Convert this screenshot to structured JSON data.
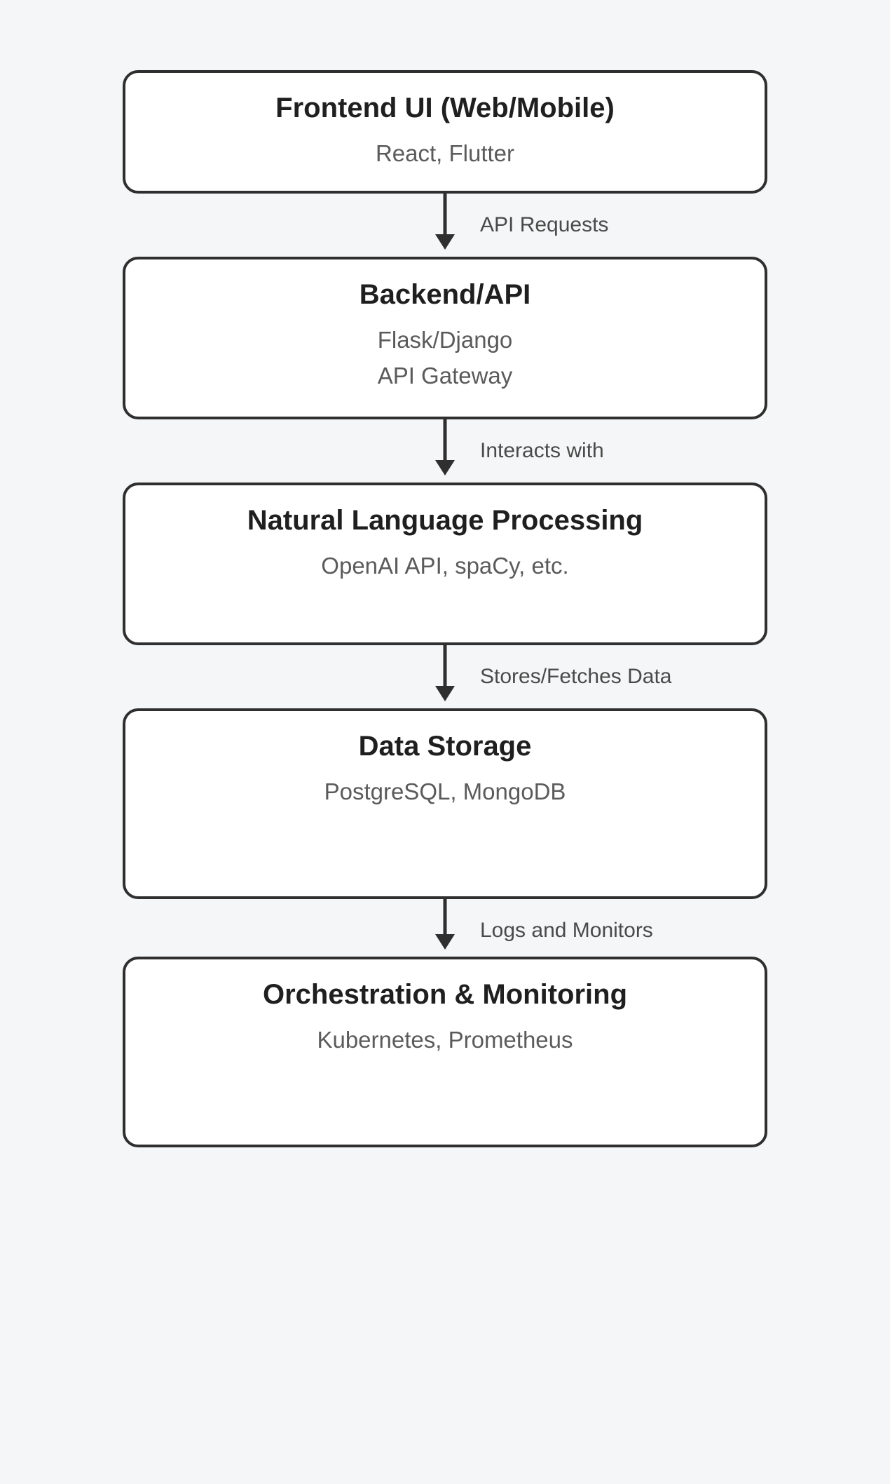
{
  "nodes": [
    {
      "title": "Frontend UI (Web/Mobile)",
      "sub": [
        "React, Flutter"
      ]
    },
    {
      "title": "Backend/API",
      "sub": [
        "Flask/Django",
        "API Gateway"
      ]
    },
    {
      "title": "Natural Language Processing",
      "sub": [
        "OpenAI API, spaCy, etc."
      ]
    },
    {
      "title": "Data Storage",
      "sub": [
        "PostgreSQL, MongoDB"
      ]
    },
    {
      "title": "Orchestration & Monitoring",
      "sub": [
        "Kubernetes, Prometheus"
      ]
    }
  ],
  "edges": [
    {
      "label": "API Requests"
    },
    {
      "label": "Interacts with"
    },
    {
      "label": "Stores/Fetches Data"
    },
    {
      "label": "Logs and Monitors"
    }
  ]
}
